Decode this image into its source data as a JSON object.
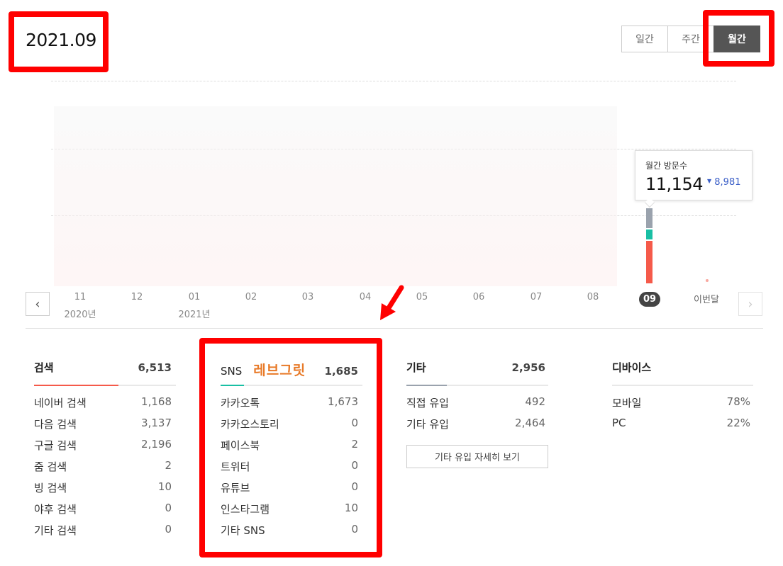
{
  "header": {
    "period": "2021.09"
  },
  "view_tabs": [
    {
      "label": "일간",
      "active": false
    },
    {
      "label": "주간",
      "active": false
    },
    {
      "label": "월간",
      "active": true
    }
  ],
  "tooltip": {
    "label": "월간 방문수",
    "value": "11,154",
    "prev_value": "8,981",
    "trend_icon": "down-triangle-icon"
  },
  "current_bar": {
    "sns_share": 0.151,
    "direct_share": 0.0,
    "search_share": 0.584,
    "other_share": 0.265,
    "colors": {
      "search": "#f55a4a",
      "sns": "#19bfa4",
      "other": "#9aa2ad"
    }
  },
  "timeline": [
    {
      "month": "11",
      "year": "2020년"
    },
    {
      "month": "12",
      "year": ""
    },
    {
      "month": "01",
      "year": "2021년"
    },
    {
      "month": "02",
      "year": ""
    },
    {
      "month": "03",
      "year": ""
    },
    {
      "month": "04",
      "year": ""
    },
    {
      "month": "05",
      "year": ""
    },
    {
      "month": "06",
      "year": ""
    },
    {
      "month": "07",
      "year": ""
    },
    {
      "month": "08",
      "year": ""
    },
    {
      "month": "09",
      "year": "",
      "current": true
    },
    {
      "month": "이번달",
      "year": ""
    }
  ],
  "panels": {
    "search": {
      "title": "검색",
      "total": "6,513",
      "accent": "#f55a4a",
      "rows": [
        {
          "label": "네이버 검색",
          "value": "1,168"
        },
        {
          "label": "다음 검색",
          "value": "3,137"
        },
        {
          "label": "구글 검색",
          "value": "2,196"
        },
        {
          "label": "줌 검색",
          "value": "2"
        },
        {
          "label": "빙 검색",
          "value": "10"
        },
        {
          "label": "야후 검색",
          "value": "0"
        },
        {
          "label": "기타 검색",
          "value": "0"
        }
      ]
    },
    "sns": {
      "title": "SNS",
      "note": "레브그릿",
      "total": "1,685",
      "accent": "#19bfa4",
      "rows": [
        {
          "label": "카카오톡",
          "value": "1,673"
        },
        {
          "label": "카카오스토리",
          "value": "0"
        },
        {
          "label": "페이스북",
          "value": "2"
        },
        {
          "label": "트위터",
          "value": "0"
        },
        {
          "label": "유튜브",
          "value": "0"
        },
        {
          "label": "인스타그램",
          "value": "10"
        },
        {
          "label": "기타 SNS",
          "value": "0"
        }
      ]
    },
    "other": {
      "title": "기타",
      "total": "2,956",
      "accent": "#9aa2ad",
      "rows": [
        {
          "label": "직접 유입",
          "value": "492"
        },
        {
          "label": "기타 유입",
          "value": "2,464"
        }
      ],
      "detail_button": "기타 유입 자세히 보기"
    },
    "device": {
      "title": "디바이스",
      "rows": [
        {
          "label": "모바일",
          "value": "78%"
        },
        {
          "label": "PC",
          "value": "22%"
        }
      ]
    }
  }
}
